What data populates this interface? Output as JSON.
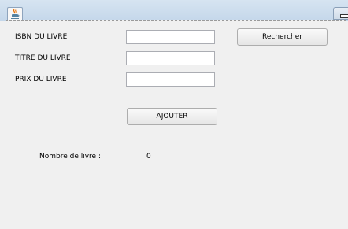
{
  "form": {
    "isbn_label": "ISBN DU LIVRE",
    "isbn_value": "",
    "title_label": "TITRE DU LIVRE",
    "title_value": "",
    "price_label": "PRIX DU LIVRE",
    "price_value": "",
    "search_button": "Rechercher",
    "add_button": "AJOUTER",
    "count_label": "Nombre de livre :",
    "count_value": "0"
  },
  "icons": {
    "app": "java-coffee-cup-icon",
    "minimize": "minimize-icon"
  }
}
